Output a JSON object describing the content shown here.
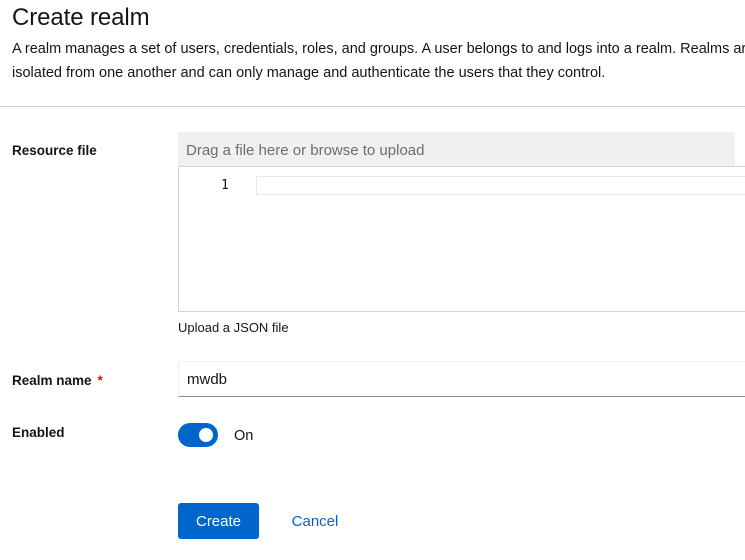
{
  "header": {
    "title": "Create realm",
    "description": "A realm manages a set of users, credentials, roles, and groups. A user belongs to and logs into a realm. Realms are isolated from one another and can only manage and authenticate the users that they control."
  },
  "resource_file": {
    "label": "Resource file",
    "placeholder": "Drag a file here or browse to upload",
    "line_number": "1",
    "helper": "Upload a JSON file"
  },
  "realm_name": {
    "label": "Realm name",
    "required_marker": "*",
    "value": "mwdb"
  },
  "enabled": {
    "label": "Enabled",
    "state_text": "On",
    "checked": true
  },
  "actions": {
    "create_label": "Create",
    "cancel_label": "Cancel"
  },
  "colors": {
    "primary": "#0066cc",
    "required": "#c9190b",
    "upload_bg": "#f0f0f0"
  }
}
